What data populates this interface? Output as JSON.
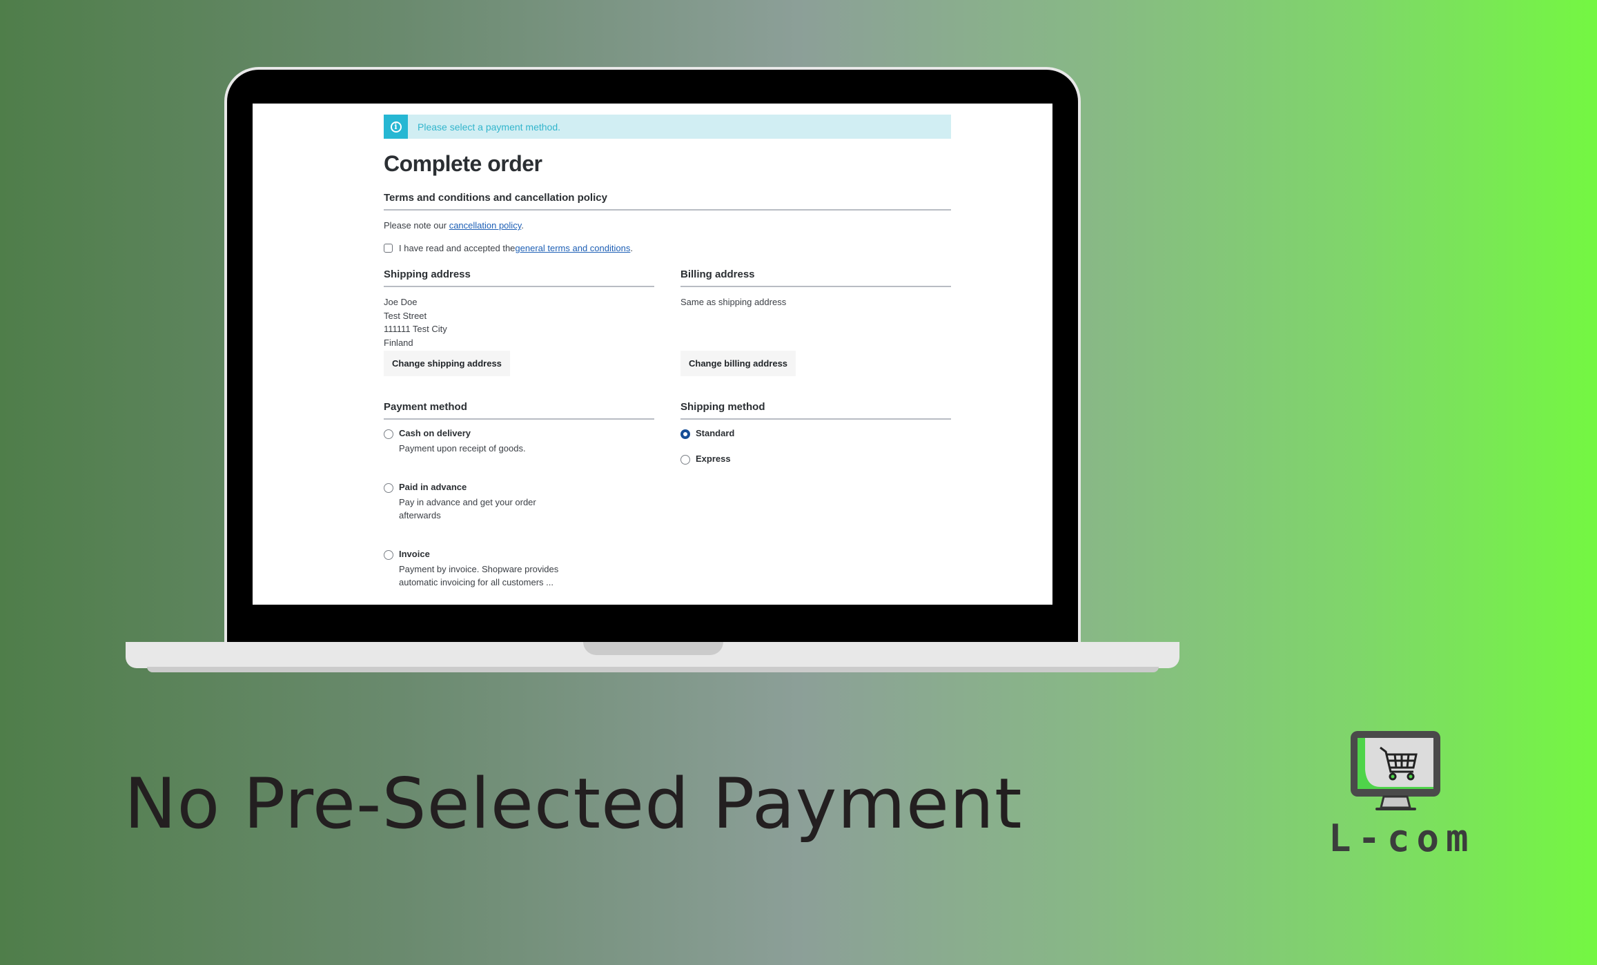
{
  "alert": {
    "icon": "info-icon",
    "message": "Please select a payment method."
  },
  "page": {
    "title": "Complete order"
  },
  "terms": {
    "title": "Terms and conditions and cancellation policy",
    "note_prefix": "Please note our ",
    "note_link": "cancellation policy",
    "note_suffix": ".",
    "accept_prefix": "I have read and accepted the ",
    "accept_link": "general terms and conditions",
    "accept_suffix": ".",
    "accepted": false
  },
  "shipping_address": {
    "title": "Shipping address",
    "lines": [
      "Joe Doe",
      "Test Street",
      "111111 Test City",
      "Finland"
    ],
    "button": "Change shipping address"
  },
  "billing_address": {
    "title": "Billing address",
    "text": "Same as shipping address",
    "button": "Change billing address"
  },
  "payment_method": {
    "title": "Payment method",
    "options": [
      {
        "label": "Cash on delivery",
        "description": "Payment upon receipt of goods.",
        "selected": false
      },
      {
        "label": "Paid in advance",
        "description": "Pay in advance and get your order afterwards",
        "selected": false
      },
      {
        "label": "Invoice",
        "description": "Payment by invoice. Shopware provides automatic invoicing for all customers ...",
        "selected": false
      }
    ]
  },
  "shipping_method": {
    "title": "Shipping method",
    "options": [
      {
        "label": "Standard",
        "selected": true
      },
      {
        "label": "Express",
        "selected": false
      }
    ]
  },
  "caption": "No Pre-Selected Payment",
  "logo": {
    "icon": "shopping-cart-monitor-icon",
    "text": "L-com"
  },
  "colors": {
    "alert_bg": "#d1eef3",
    "alert_icon_bg": "#26b7d3",
    "link": "#1d5fb5",
    "radio_selected": "#174e96"
  }
}
